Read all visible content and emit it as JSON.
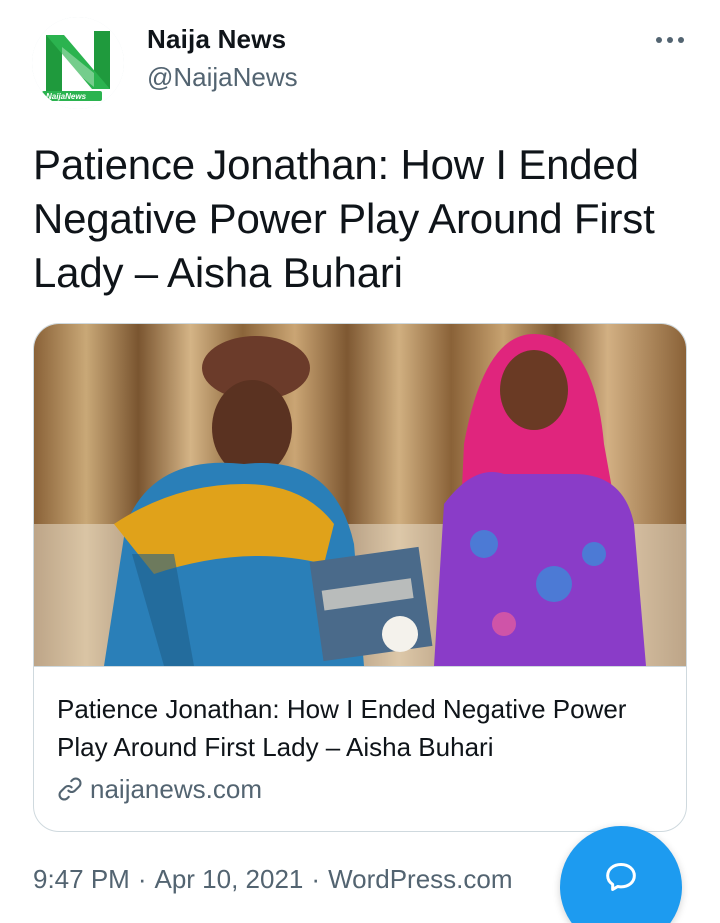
{
  "account": {
    "display_name": "Naija News",
    "handle": "@NaijaNews",
    "avatar_logo_text": "NaijaNews",
    "brand_green": "#1f9a3d"
  },
  "tweet": {
    "text": "Patience Jonathan: How I Ended Negative Power Play Around First Lady – Aisha Buhari",
    "time": "9:47 PM",
    "date": "Apr 10, 2021",
    "source": "WordPress.com",
    "separator": "·"
  },
  "card": {
    "title": "Patience Jonathan: How I Ended Negative Power Play Around First Lady – Aisha Buhari",
    "domain": "naijanews.com",
    "domain_icon": "link-icon",
    "image_caption": "Two women holding a book in front of golden curtains"
  },
  "actions": {
    "more_icon": "more-icon",
    "compose_icon": "chat-bubble-icon"
  },
  "colors": {
    "accent": "#1d9bf0",
    "text_primary": "#0f1419",
    "text_secondary": "#536471",
    "border": "#cfd9de"
  }
}
